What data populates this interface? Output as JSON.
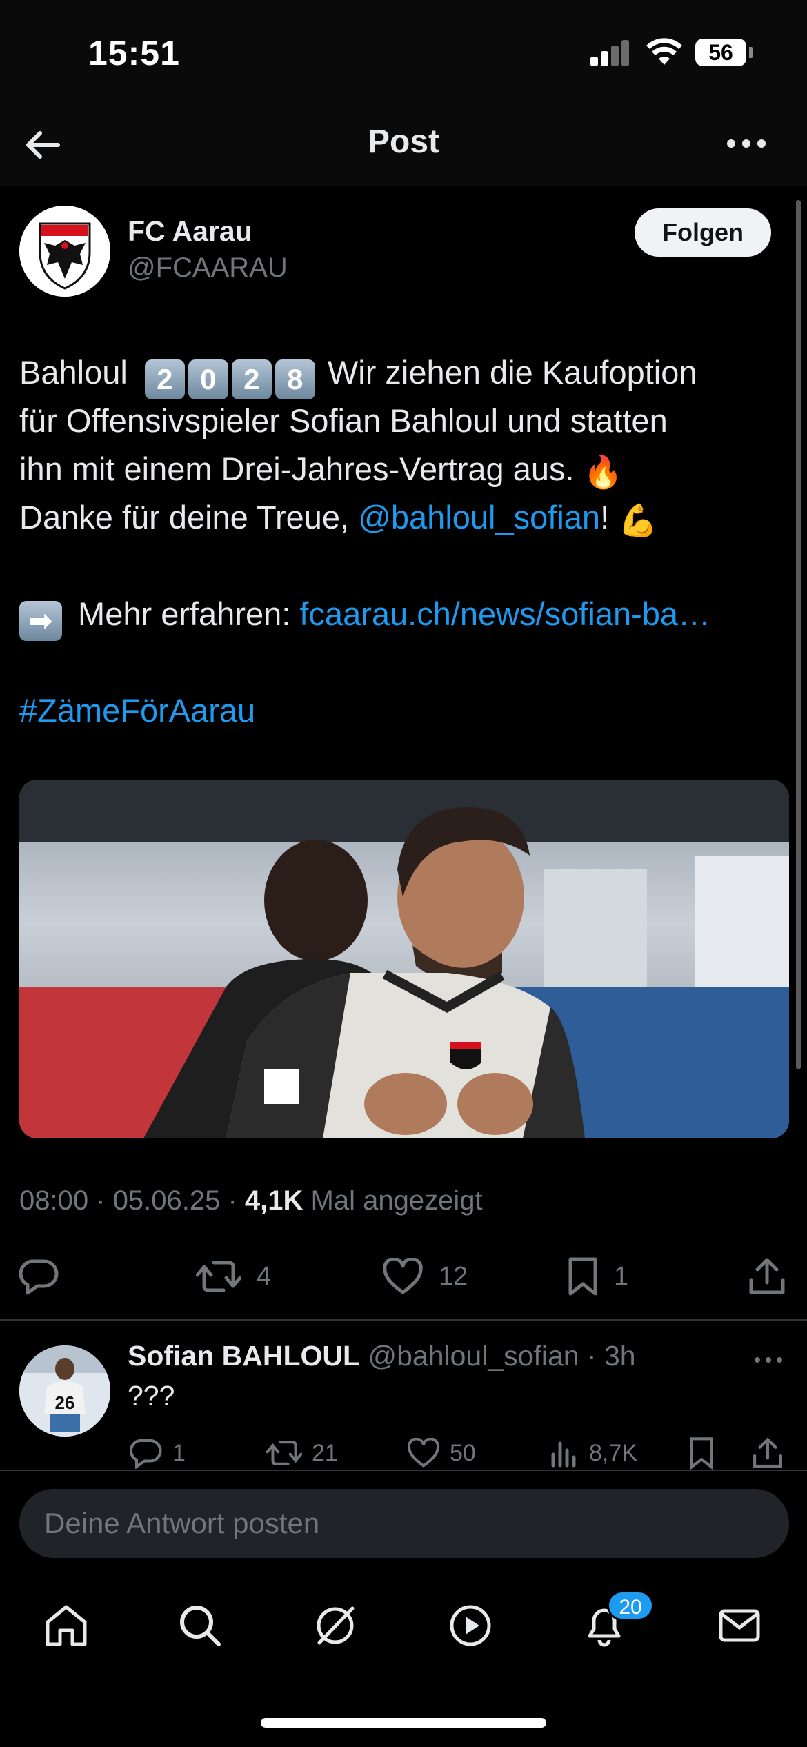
{
  "status_bar": {
    "time": "15:51",
    "battery": "56"
  },
  "header": {
    "title": "Post"
  },
  "post": {
    "author_name": "FC Aarau",
    "author_handle": "@FCAARAU",
    "follow_label": "Folgen",
    "text_start": "Bahloul",
    "keycaps": [
      "2",
      "0",
      "2",
      "8"
    ],
    "text_line1_rest": " Wir ziehen die Kaufoption",
    "text_line2": "für Offensivspieler Sofian Bahloul und statten",
    "text_line3": "ihn mit einem Drei-Jahres-Vertrag aus. ",
    "text_line4_start": "Danke für deine Treue, ",
    "mention": "@bahloul_sofian",
    "text_line4_end": "! ",
    "more_label": " Mehr erfahren: ",
    "link_text": "fcaarau.ch/news/sofian-ba…",
    "hashtag": "#ZämeFörAarau",
    "timestamp": "08:00 · 05.06.25 · ",
    "views_count": "4,1K",
    "views_label": " Mal angezeigt",
    "retweets": "4",
    "likes": "12",
    "bookmarks": "1"
  },
  "reply": {
    "name": "Sofian BAHLOUL",
    "handle_time": " @bahloul_sofian · 3h",
    "text": "???",
    "replies": "1",
    "retweets": "21",
    "likes": "50",
    "views": "8,7K"
  },
  "composer": {
    "placeholder": "Deine Antwort posten"
  },
  "tabbar": {
    "notification_count": "20"
  },
  "colors": {
    "accent": "#1d9bf0",
    "background": "#000000",
    "muted": "#71767b"
  }
}
